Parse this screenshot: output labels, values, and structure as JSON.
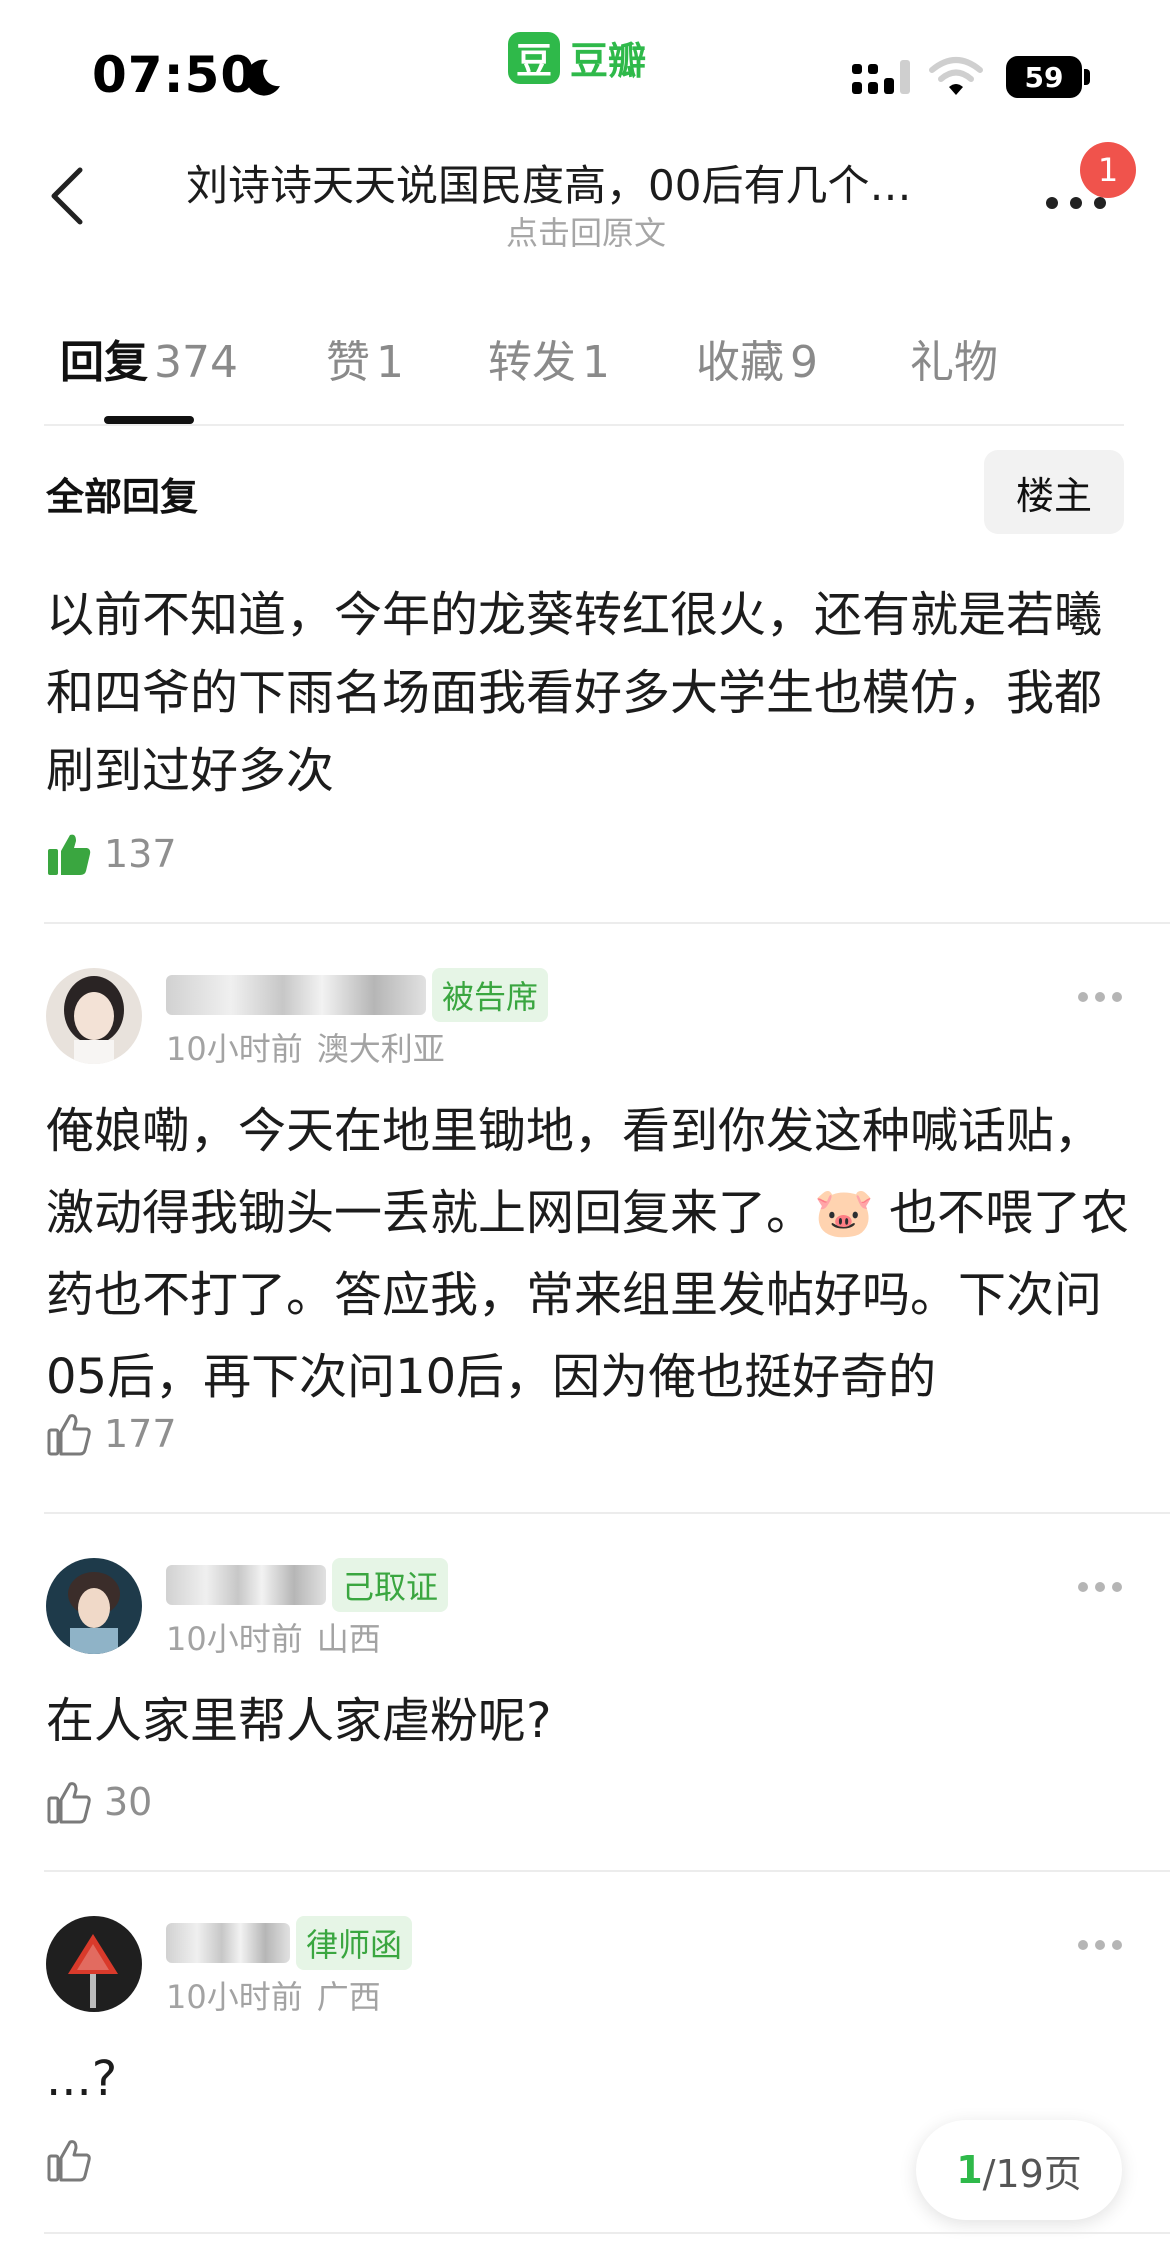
{
  "status_bar": {
    "time": "07:50",
    "app_name": "豆瓣",
    "app_logo_char": "豆",
    "battery": "59"
  },
  "nav": {
    "title": "刘诗诗天天说国民度高，00后有几个…",
    "subtitle": "点击回原文",
    "notification_count": "1"
  },
  "tabs": [
    {
      "label": "回复",
      "count": "374",
      "active": true
    },
    {
      "label": "赞",
      "count": "1"
    },
    {
      "label": "转发",
      "count": "1"
    },
    {
      "label": "收藏",
      "count": "9"
    },
    {
      "label": "礼物",
      "count": ""
    }
  ],
  "filter": {
    "label": "全部回复",
    "op_button": "楼主"
  },
  "top_post": {
    "text": "以前不知道，今年的龙葵转红很火，还有就是若曦和四爷的下雨名场面我看好多大学生也模仿，我都刷到过好多次",
    "likes": "137",
    "liked": true
  },
  "comments": [
    {
      "tag": "被告席",
      "time": "10小时前",
      "location": "澳大利亚",
      "text": "俺娘嘞，今天在地里锄地，看到你发这种喊话贴，激动得我锄头一丢就上网回复来了。🐷 也不喂了农药也不打了。答应我，常来组里发帖好吗。下次问05后，再下次问10后，因为俺也挺好奇的",
      "likes": "177"
    },
    {
      "tag": "己取证",
      "time": "10小时前",
      "location": "山西",
      "text": "在人家里帮人家虐粉呢?",
      "likes": "30"
    },
    {
      "tag": "律师函",
      "time": "10小时前",
      "location": "广西",
      "text": "...?",
      "likes": ""
    }
  ],
  "pager": {
    "current": "1",
    "total": "/19页"
  },
  "colors": {
    "brand_green": "#2fb94a",
    "tag_bg": "#e6f5e6",
    "badge_red": "#f0534c"
  }
}
